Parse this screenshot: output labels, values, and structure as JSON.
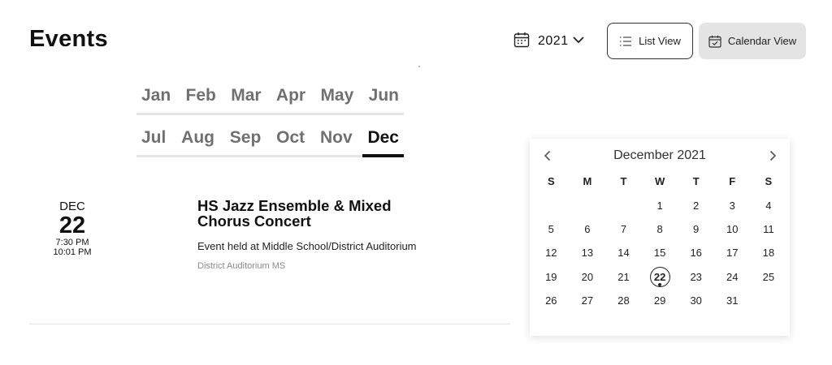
{
  "header": {
    "title": "Events",
    "year": "2021",
    "list_view_label": "List View",
    "calendar_view_label": "Calendar View"
  },
  "months": {
    "row1": [
      "Jan",
      "Feb",
      "Mar",
      "Apr",
      "May",
      "Jun"
    ],
    "row2": [
      "Jul",
      "Aug",
      "Sep",
      "Oct",
      "Nov",
      "Dec"
    ],
    "selected": "Dec"
  },
  "event": {
    "month": "DEC",
    "day": "22",
    "start_time": "7:30 PM",
    "end_time": "10:01 PM",
    "title": "HS Jazz Ensemble & Mixed Chorus Concert",
    "description": "Event held at Middle School/District Auditorium",
    "location": "District Auditorium MS"
  },
  "calendar": {
    "title": "December 2021",
    "weekdays": [
      "S",
      "M",
      "T",
      "W",
      "T",
      "F",
      "S"
    ],
    "leading_blanks": 3,
    "days": [
      "1",
      "2",
      "3",
      "4",
      "5",
      "6",
      "7",
      "8",
      "9",
      "10",
      "11",
      "12",
      "13",
      "14",
      "15",
      "16",
      "17",
      "18",
      "19",
      "20",
      "21",
      "22",
      "23",
      "24",
      "25",
      "26",
      "27",
      "28",
      "29",
      "30",
      "31"
    ],
    "selected_day": "22",
    "event_days": [
      "22"
    ]
  },
  "icons": {
    "year_picker": "calendar-icon",
    "year_dropdown": "chevron-down-icon",
    "list_view": "list-icon",
    "calendar_view": "calendar-check-icon",
    "prev_month": "chevron-left-icon",
    "next_month": "chevron-right-icon"
  }
}
